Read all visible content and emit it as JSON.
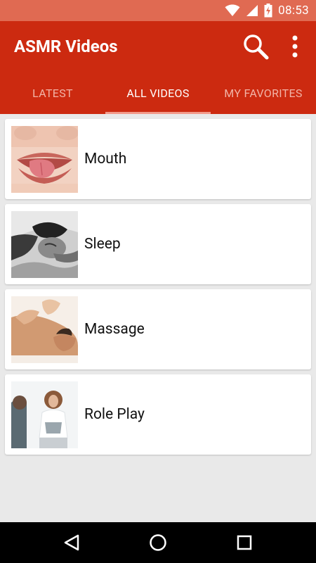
{
  "status_bar": {
    "time": "08:53"
  },
  "app_bar": {
    "title": "ASMR Videos"
  },
  "tabs": [
    {
      "label": "LATEST",
      "active": false
    },
    {
      "label": "ALL VIDEOS",
      "active": true
    },
    {
      "label": "MY FAVORITES",
      "active": false
    }
  ],
  "categories": [
    {
      "label": "Mouth",
      "thumbnail": "lips-tongue-photo"
    },
    {
      "label": "Sleep",
      "thumbnail": "sleeping-woman-bw-photo"
    },
    {
      "label": "Massage",
      "thumbnail": "back-massage-photo"
    },
    {
      "label": "Role Play",
      "thumbnail": "consultation-photo"
    }
  ],
  "colors": {
    "status_bar": "#e06a52",
    "app_bar": "#cc2a10",
    "tab_inactive": "#f2b3a6",
    "tab_indicator": "#f29a8a",
    "background": "#e9e9e9"
  },
  "icons": [
    "wifi-icon",
    "signal-icon",
    "battery-charging-icon",
    "search-icon",
    "more-vert-icon",
    "back-icon",
    "home-icon",
    "recents-icon"
  ]
}
